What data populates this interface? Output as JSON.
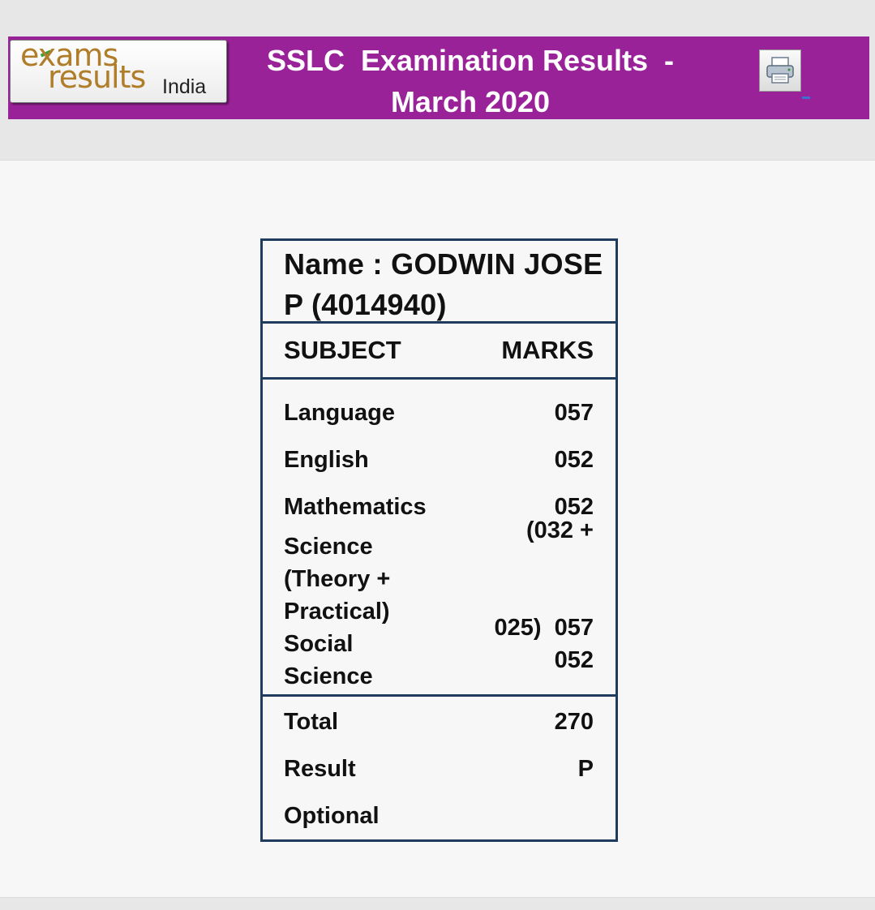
{
  "header": {
    "logo": {
      "line1": "exams",
      "line2": "results",
      "tag": "India"
    },
    "title_line1": "SSLC  Examination Results  -",
    "title_line2": "March 2020",
    "print_icon": "printer-icon"
  },
  "student": {
    "name_line1": "Name : GODWIN JOSE",
    "name_line2": "P  (4014940)"
  },
  "table": {
    "col_subject": "SUBJECT",
    "col_marks": "MARKS",
    "subjects": [
      {
        "name": "Language",
        "marks": "057"
      },
      {
        "name": "English",
        "marks": "052"
      },
      {
        "name": "Mathematics",
        "marks": "052"
      },
      {
        "name_lines": [
          "Science",
          "(Theory +",
          "Practical)"
        ],
        "marks_lines": [
          "(032 +",
          "025)  057"
        ]
      },
      {
        "name_lines": [
          "Social",
          "Science"
        ],
        "marks": "052"
      }
    ],
    "summary": [
      {
        "label": "Total",
        "value": "270"
      },
      {
        "label": "Result",
        "value": "P"
      },
      {
        "label": "Optional",
        "value": ""
      }
    ]
  },
  "colors": {
    "header_bg": "#9a2298",
    "border": "#1f3c5e",
    "logo_text": "#b07d2a"
  }
}
